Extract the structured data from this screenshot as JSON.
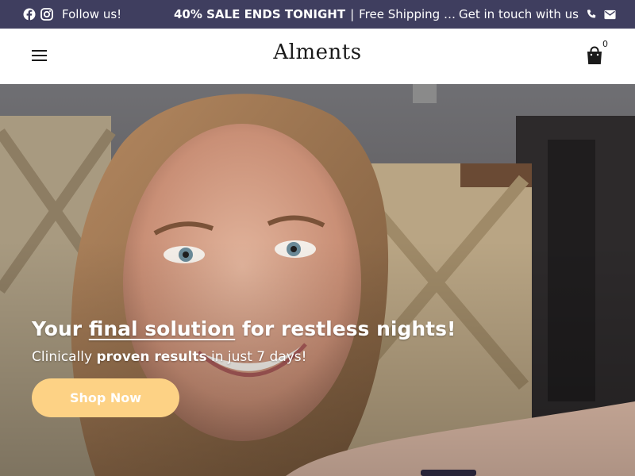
{
  "topbar": {
    "follow_text": "Follow us!",
    "promo_strong": "40% SALE ENDS TONIGHT",
    "promo_sep": "|",
    "promo_rest": "Free Shipping Ov...",
    "contact_text": "Get in touch with us",
    "icons": [
      "facebook-icon",
      "instagram-icon",
      "phone-icon",
      "mail-icon"
    ],
    "bg_color": "#3f3e5f"
  },
  "header": {
    "logo": "Alments",
    "cart_count": "0",
    "icons": [
      "menu-icon",
      "shopping-bag-icon"
    ]
  },
  "hero": {
    "headline_pre": "Your ",
    "headline_underlined": "final solution",
    "headline_post": " for restless nights!",
    "sub_pre": "Clinically ",
    "sub_bold": "proven results",
    "sub_post": " in just 7 days!",
    "cta_label": "Shop Now",
    "cta_color": "#fdd285"
  }
}
